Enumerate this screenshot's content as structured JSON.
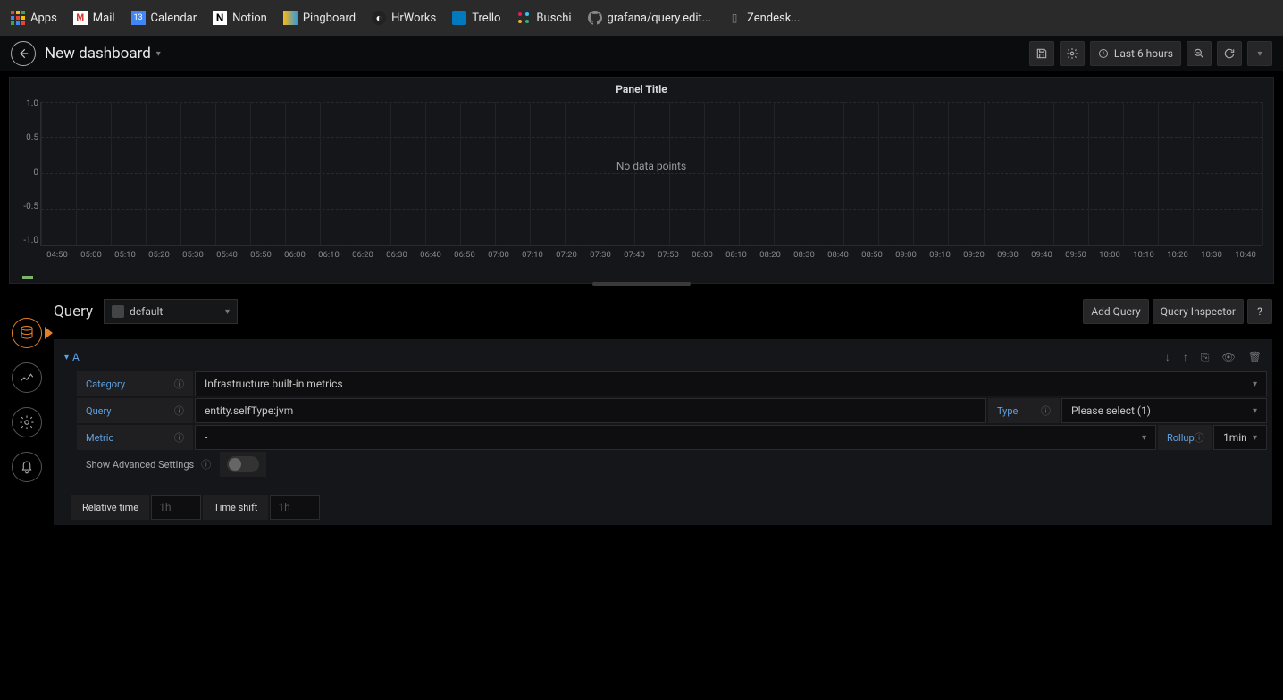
{
  "bookmarks": [
    {
      "label": "Apps",
      "icon": "apps"
    },
    {
      "label": "Mail",
      "icon": "gmail"
    },
    {
      "label": "Calendar",
      "icon": "calendar"
    },
    {
      "label": "Notion",
      "icon": "notion"
    },
    {
      "label": "Pingboard",
      "icon": "pingboard"
    },
    {
      "label": "HrWorks",
      "icon": "hrworks"
    },
    {
      "label": "Trello",
      "icon": "trello"
    },
    {
      "label": "Buschi",
      "icon": "slack"
    },
    {
      "label": "grafana/query.edit...",
      "icon": "github"
    },
    {
      "label": "Zendesk...",
      "icon": "zendesk"
    }
  ],
  "header": {
    "title": "New dashboard",
    "time_range": "Last 6 hours"
  },
  "panel": {
    "title": "Panel Title",
    "no_data": "No data points"
  },
  "chart_data": {
    "type": "line",
    "series": [],
    "no_data": true,
    "y_ticks": [
      "1.0",
      "0.5",
      "0",
      "-0.5",
      "-1.0"
    ],
    "ylim": [
      -1.0,
      1.0
    ],
    "x_ticks": [
      "04:50",
      "05:00",
      "05:10",
      "05:20",
      "05:30",
      "05:40",
      "05:50",
      "06:00",
      "06:10",
      "06:20",
      "06:30",
      "06:40",
      "06:50",
      "07:00",
      "07:10",
      "07:20",
      "07:30",
      "07:40",
      "07:50",
      "08:00",
      "08:10",
      "08:20",
      "08:30",
      "08:40",
      "08:50",
      "09:00",
      "09:10",
      "09:20",
      "09:30",
      "09:40",
      "09:50",
      "10:00",
      "10:10",
      "10:20",
      "10:30",
      "10:40"
    ]
  },
  "query_section": {
    "title": "Query",
    "datasource": "default",
    "add_query": "Add Query",
    "inspector": "Query Inspector",
    "help": "?"
  },
  "query_row": {
    "letter": "A",
    "category_label": "Category",
    "category_value": "Infrastructure built-in metrics",
    "query_label": "Query",
    "query_value": "entity.selfType:jvm",
    "type_label": "Type",
    "type_value": "Please select (1)",
    "metric_label": "Metric",
    "metric_value": "-",
    "rollup_label": "Rollup",
    "rollup_value": "1min",
    "advanced_label": "Show Advanced Settings"
  },
  "time_opts": {
    "relative_label": "Relative time",
    "relative_placeholder": "1h",
    "shift_label": "Time shift",
    "shift_placeholder": "1h"
  }
}
